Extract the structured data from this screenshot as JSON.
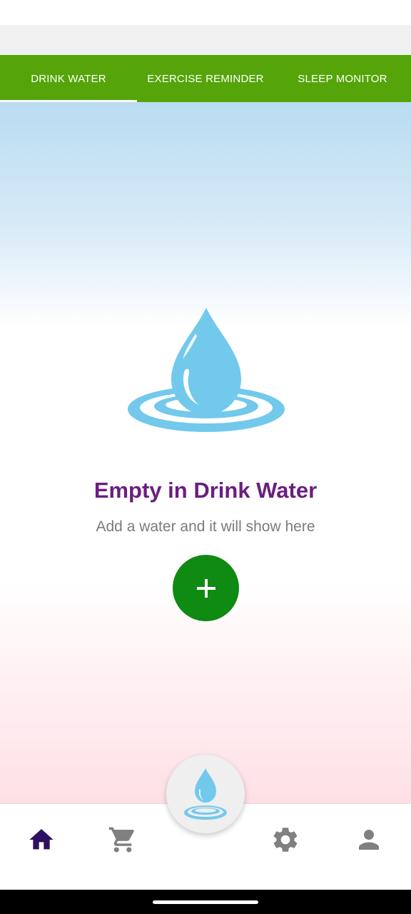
{
  "tabs": [
    {
      "label": "DRINK WATER",
      "active": true
    },
    {
      "label": "EXERCISE REMINDER",
      "active": false
    },
    {
      "label": "SLEEP MONITOR",
      "active": false
    }
  ],
  "empty_state": {
    "title": "Empty in Drink Water",
    "subtitle": "Add a water and it will show here",
    "icon": "water-drop-icon"
  },
  "add_button": {
    "icon": "plus-icon"
  },
  "bottom_nav": [
    {
      "icon": "home-icon",
      "active": true
    },
    {
      "icon": "cart-icon",
      "active": false
    },
    {
      "icon": "water-drop-icon",
      "active": false
    },
    {
      "icon": "gear-icon",
      "active": false
    },
    {
      "icon": "person-icon",
      "active": false
    }
  ],
  "colors": {
    "tab_bar": "#55a50a",
    "title": "#6a1e80",
    "subtitle": "#7b7b7b",
    "add_button": "#0f8a12",
    "drop": "#72c9ec",
    "nav_active": "#2d1062",
    "nav_inactive": "#808080"
  }
}
